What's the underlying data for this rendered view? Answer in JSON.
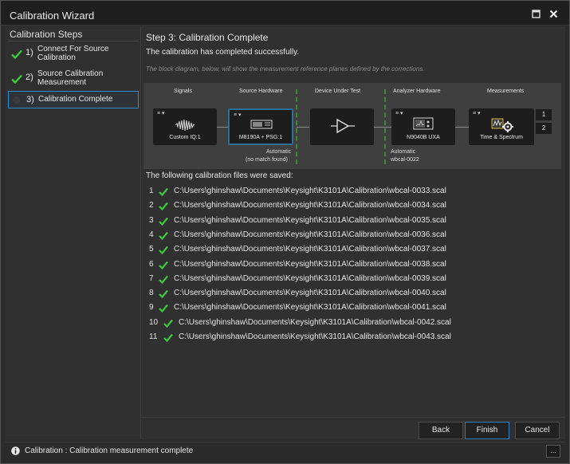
{
  "window": {
    "title": "Calibration Wizard"
  },
  "sidebar": {
    "heading": "Calibration Steps",
    "steps": [
      {
        "num": "1)",
        "label": "Connect For Source Calibration",
        "state": "done"
      },
      {
        "num": "2)",
        "label": "Source Calibration Measurement",
        "state": "done"
      },
      {
        "num": "3)",
        "label": "Calibration Complete",
        "state": "current"
      }
    ]
  },
  "main": {
    "title": "Step 3: Calibration Complete",
    "success": "The calibration has completed successfully.",
    "note": "The block diagram, below, will show the measurement reference planes defined by the corrections."
  },
  "diagram": {
    "columns": [
      "Signals",
      "Source Hardware",
      "Device Under Test",
      "Analyzer Hardware",
      "Measurements"
    ],
    "blocks": {
      "signal": "Custom IQ:1",
      "source": "M8190A + PSG:1",
      "analyzer": "N9040B UXA",
      "measurement": "Time & Spectrum"
    },
    "source_note_1": "Automatic",
    "source_note_2": "(no match found)",
    "analyzer_note_1": "Automatic",
    "analyzer_note_2": "wbcal-0022",
    "ports": [
      "1",
      "2"
    ],
    "menu_glyph": "≡ ▾"
  },
  "files": {
    "heading": "The following calibration files were saved:",
    "items": [
      {
        "n": "1",
        "path": "C:\\Users\\ghinshaw\\Documents\\Keysight\\K3101A\\Calibration\\wbcal-0033.scal"
      },
      {
        "n": "2",
        "path": "C:\\Users\\ghinshaw\\Documents\\Keysight\\K3101A\\Calibration\\wbcal-0034.scal"
      },
      {
        "n": "3",
        "path": "C:\\Users\\ghinshaw\\Documents\\Keysight\\K3101A\\Calibration\\wbcal-0035.scal"
      },
      {
        "n": "4",
        "path": "C:\\Users\\ghinshaw\\Documents\\Keysight\\K3101A\\Calibration\\wbcal-0036.scal"
      },
      {
        "n": "5",
        "path": "C:\\Users\\ghinshaw\\Documents\\Keysight\\K3101A\\Calibration\\wbcal-0037.scal"
      },
      {
        "n": "6",
        "path": "C:\\Users\\ghinshaw\\Documents\\Keysight\\K3101A\\Calibration\\wbcal-0038.scal"
      },
      {
        "n": "7",
        "path": "C:\\Users\\ghinshaw\\Documents\\Keysight\\K3101A\\Calibration\\wbcal-0039.scal"
      },
      {
        "n": "8",
        "path": "C:\\Users\\ghinshaw\\Documents\\Keysight\\K3101A\\Calibration\\wbcal-0040.scal"
      },
      {
        "n": "9",
        "path": "C:\\Users\\ghinshaw\\Documents\\Keysight\\K3101A\\Calibration\\wbcal-0041.scal"
      },
      {
        "n": "10",
        "path": "C:\\Users\\ghinshaw\\Documents\\Keysight\\K3101A\\Calibration\\wbcal-0042.scal"
      },
      {
        "n": "11",
        "path": "C:\\Users\\ghinshaw\\Documents\\Keysight\\K3101A\\Calibration\\wbcal-0043.scal"
      }
    ]
  },
  "buttons": {
    "back": "Back",
    "finish": "Finish",
    "cancel": "Cancel"
  },
  "status": {
    "text": "Calibration : Calibration measurement complete",
    "more": "..."
  },
  "colors": {
    "accent": "#2b7fc0",
    "check": "#3cc93c",
    "reference_plane": "#3e8a3b"
  }
}
